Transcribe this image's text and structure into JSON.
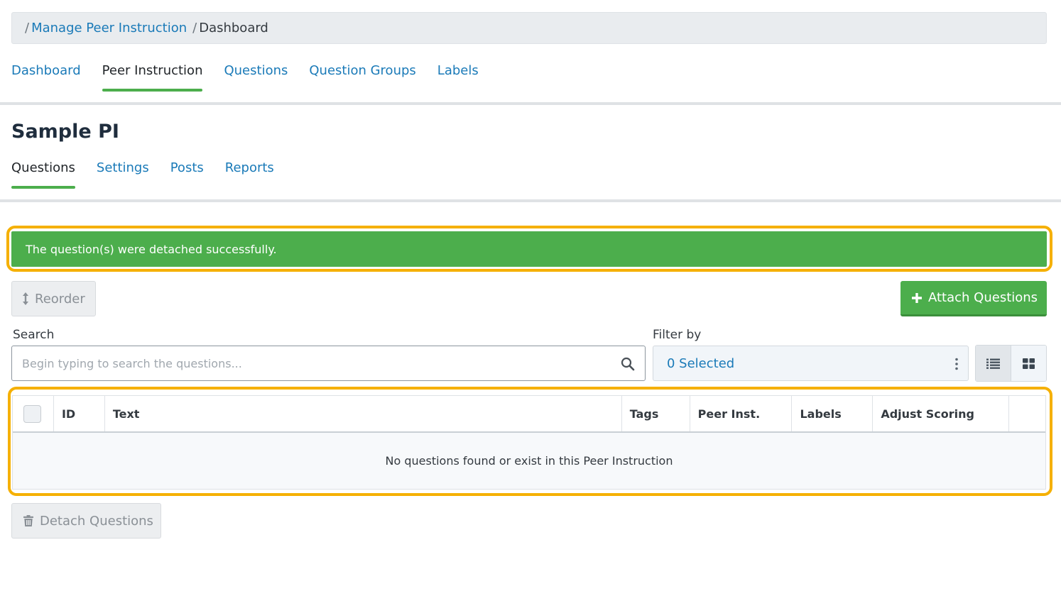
{
  "breadcrumb": {
    "separator": "/",
    "parent": "Manage Peer Instruction",
    "current": "Dashboard"
  },
  "top_nav": {
    "tabs": [
      "Dashboard",
      "Peer Instruction",
      "Questions",
      "Question Groups",
      "Labels"
    ],
    "active": "Peer Instruction"
  },
  "page": {
    "title": "Sample PI"
  },
  "sub_nav": {
    "tabs": [
      "Questions",
      "Settings",
      "Posts",
      "Reports"
    ],
    "active": "Questions"
  },
  "alert": {
    "message": "The question(s) were detached successfully."
  },
  "toolbar": {
    "reorder_label": "Reorder",
    "attach_label": "Attach Questions"
  },
  "search": {
    "label": "Search",
    "placeholder": "Begin typing to search the questions..."
  },
  "filter": {
    "label": "Filter by",
    "selected": "0 Selected"
  },
  "table": {
    "columns": [
      "ID",
      "Text",
      "Tags",
      "Peer Inst.",
      "Labels",
      "Adjust Scoring",
      ""
    ],
    "empty_message": "No questions found or exist in this Peer Instruction"
  },
  "footer": {
    "detach_label": "Detach Questions"
  },
  "colors": {
    "link": "#1a7ab8",
    "success": "#4cae4c",
    "highlight": "#f5b000"
  },
  "icons": {
    "reorder": "arrows-vertical-icon",
    "attach": "plus-icon",
    "search": "search-icon",
    "filter_menu": "kebab-icon",
    "list_view": "list-view-icon",
    "grid_view": "grid-view-icon",
    "detach": "trash-icon"
  }
}
